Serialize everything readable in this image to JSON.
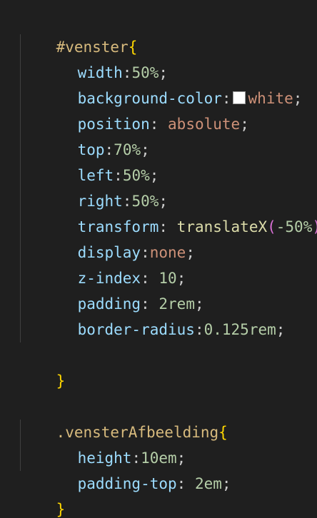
{
  "editor": {
    "lines": [
      {
        "selector": "#venster",
        "open": "{"
      },
      {
        "property": "width",
        "sep": ":",
        "value": "50%",
        "end": ";"
      },
      {
        "property": "background-color",
        "sep": ":",
        "value": "white",
        "end": ";",
        "swatch_color": "#ffffff"
      },
      {
        "property": "position",
        "sep": ": ",
        "value": "absolute",
        "end": ";"
      },
      {
        "property": "top",
        "sep": ":",
        "value": "70%",
        "end": ";"
      },
      {
        "property": "left",
        "sep": ":",
        "value": "50%",
        "end": ";"
      },
      {
        "property": "right",
        "sep": ":",
        "value": "50%",
        "end": ";"
      },
      {
        "property": "transform",
        "sep": ": ",
        "func": "translateX",
        "paren_open": "(",
        "value": "-50%",
        "paren_close": ")"
      },
      {
        "property": "display",
        "sep": ":",
        "value": "none",
        "end": ";"
      },
      {
        "property": "z-index",
        "sep": ": ",
        "value": "10",
        "end": ";"
      },
      {
        "property": "padding",
        "sep": ": ",
        "value": "2rem",
        "end": ";"
      },
      {
        "property": "border-radius",
        "sep": ":",
        "value": "0.125rem",
        "end": ";"
      },
      {
        "close": "}"
      },
      {
        "selector": ".vensterAfbeelding",
        "open": "{"
      },
      {
        "property": "height",
        "sep": ":",
        "value": "10em",
        "end": ";"
      },
      {
        "property": "padding-top",
        "sep": ": ",
        "value": "2em",
        "end": ";"
      },
      {
        "close": "}"
      }
    ]
  },
  "colors": {
    "background": "#1f1f1f",
    "selector": "#d7ba7d",
    "brace": "#ffd700",
    "property": "#9cdcfe",
    "number": "#b5cea8",
    "keyword": "#ce9178",
    "function": "#dcdcaa",
    "paren": "#da70d6"
  }
}
